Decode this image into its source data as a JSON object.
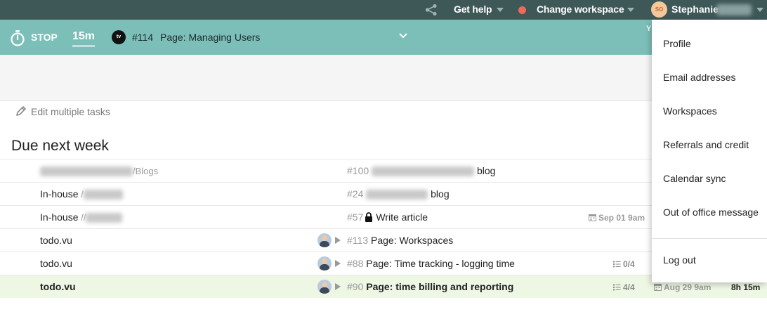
{
  "topbar": {
    "share_icon": "share-icon",
    "get_help": "Get help",
    "change_workspace": "Change workspace",
    "status_color": "#f06a5a",
    "avatar_initials": "SO",
    "user_name": "Stephanie"
  },
  "timer": {
    "stop_label": "STOP",
    "elapsed": "15m",
    "project_logo": "tv",
    "task_number": "#114",
    "task_title": "Page: Managing Users",
    "truncated_text": "Y"
  },
  "toolbar": {
    "edit_multiple": "Edit multiple tasks"
  },
  "section": {
    "title": "Due next week"
  },
  "tasks": [
    {
      "project": "",
      "project_sub": "/Blogs",
      "number": "#100",
      "title": "blog",
      "locked": false,
      "checklist": "",
      "due": "",
      "tracked": ""
    },
    {
      "project": "In-house",
      "project_sub": " /",
      "number": "#24",
      "title": "blog",
      "locked": false,
      "checklist": "",
      "due": "",
      "tracked": ""
    },
    {
      "project": "In-house",
      "project_sub": " //",
      "number": "#57",
      "title": "Write article",
      "locked": true,
      "checklist": "",
      "due": "Sep 01 9am",
      "tracked": ""
    },
    {
      "project": "todo.vu",
      "project_sub": "",
      "number": "#113",
      "title": "Page: Workspaces",
      "locked": false,
      "checklist": "",
      "due": "",
      "tracked": ""
    },
    {
      "project": "todo.vu",
      "project_sub": "",
      "number": "#88",
      "title": "Page: Time tracking - logging time",
      "locked": false,
      "checklist": "0/4",
      "due": "",
      "tracked": ""
    },
    {
      "project": "todo.vu",
      "project_sub": "",
      "number": "#90",
      "title": "Page: time billing and reporting",
      "locked": false,
      "checklist": "4/4",
      "due": "Aug 29 9am",
      "tracked": "8h 15m"
    }
  ],
  "user_menu": {
    "items": [
      "Profile",
      "Email addresses",
      "Workspaces",
      "Referrals and credit",
      "Calendar sync",
      "Out of office message"
    ],
    "logout": "Log out"
  },
  "colors": {
    "topbar": "#3e5757",
    "timerbar": "#7cbfb8",
    "selected_row": "#eef6e4"
  }
}
